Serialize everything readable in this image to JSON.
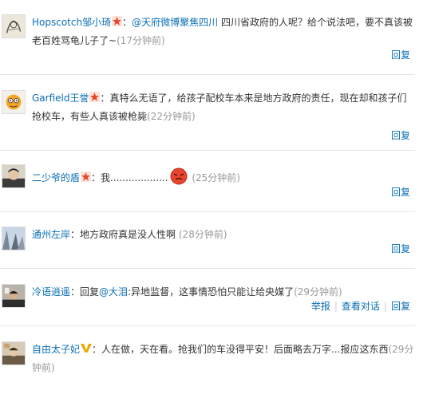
{
  "comments": [
    {
      "user": "Hopscotch邹小琦",
      "badge": "star",
      "mention": "@天府微博聚焦四川",
      "text": " 四川省政府的人呢？给个说法吧，要不真该被老百姓骂龟儿子了~",
      "time": "(17分钟前)",
      "actions": [
        "回复"
      ]
    },
    {
      "user": "Garfield王誉",
      "badge": "star",
      "text": "真特么无语了，给孩子配校车本来是地方政府的责任，现在却和孩子们抢校车，有些人真该被枪毙",
      "time": "(22分钟前)",
      "actions": [
        "回复"
      ]
    },
    {
      "user": "二少爷的盾",
      "badge": "star",
      "text": "我...................",
      "emoji": "angry-face",
      "time": "(25分钟前)",
      "actions": [
        "回复"
      ]
    },
    {
      "user": "通州左岸",
      "text": "地方政府真是没人性啊",
      "time": "(28分钟前)",
      "actions": [
        "回复"
      ]
    },
    {
      "user": "冷语逍遥",
      "reply_prefix": "回复",
      "mention": "@大泪",
      "text": ":异地监督，这事情恐怕只能让给央媒了",
      "time": "(29分钟前)",
      "actions": [
        "举报",
        "查看对话",
        "回复"
      ]
    },
    {
      "user": "自由太子妃",
      "badge": "v",
      "text": "人在做，天在看。抢我们的车没得平安！后面略去万字...报应这东西",
      "time": "(29分钟前)",
      "actions": []
    }
  ],
  "colors": {
    "link": "#0a6fb4",
    "text": "#333333",
    "time": "#999999",
    "star": "#e8452e",
    "v_badge": "#e8a800",
    "divider": "#e6e6e6"
  }
}
